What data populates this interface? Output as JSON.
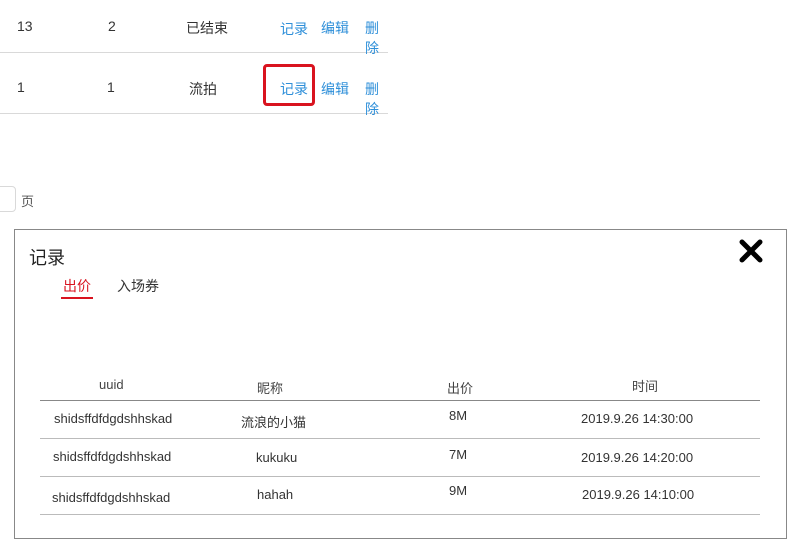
{
  "list_rows": [
    {
      "col1": "13",
      "col2": "2",
      "status": "已结束",
      "record": "记录",
      "edit": "编辑",
      "delete": "删除"
    },
    {
      "col1": "1",
      "col2": "1",
      "status": "流拍",
      "record": "记录",
      "edit": "编辑",
      "delete": "删除"
    }
  ],
  "pagination": {
    "page_input_value": "",
    "page_suffix": "页"
  },
  "modal": {
    "title": "记录",
    "tabs": [
      {
        "label": "出价",
        "active": true
      },
      {
        "label": "入场券",
        "active": false
      }
    ],
    "table": {
      "headers": [
        "uuid",
        "昵称",
        "出价",
        "时间"
      ],
      "rows": [
        {
          "uuid": "shidsffdfdgdshhskad",
          "nickname": "流浪的小猫",
          "bid": "8M",
          "time": "2019.9.26  14:30:00"
        },
        {
          "uuid": "shidsffdfdgdshhskad",
          "nickname": "kukuku",
          "bid": "7M",
          "time": "2019.9.26  14:20:00"
        },
        {
          "uuid": "shidsffdfdgdshhskad",
          "nickname": "hahah",
          "bid": "9M",
          "time": "2019.9.26  14:10:00"
        }
      ]
    }
  },
  "colors": {
    "link": "#2e8fd9",
    "accent": "#d9131f"
  },
  "icons": {
    "close": "close-icon"
  }
}
